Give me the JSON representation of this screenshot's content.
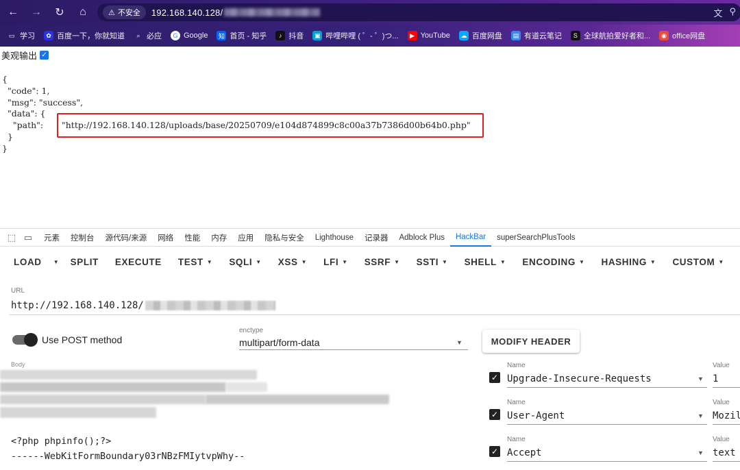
{
  "browser": {
    "security_label": "不安全",
    "address": "192.168.140.128/",
    "bookmarks": [
      {
        "label": "学习",
        "icon": "folder-icon",
        "color": "#f0eef9"
      },
      {
        "label": "百度一下，你就知道",
        "icon": "baidu-icon",
        "color": "#2932e1"
      },
      {
        "label": "必应",
        "icon": "search-icon",
        "color": "#5b9bd5"
      },
      {
        "label": "Google",
        "icon": "google-icon",
        "color": "#ffffff"
      },
      {
        "label": "首页 - 知乎",
        "icon": "zhihu-icon",
        "color": "#0066ff"
      },
      {
        "label": "抖音",
        "icon": "douyin-icon",
        "color": "#111111"
      },
      {
        "label": "哔哩哔哩 ( ゜- ゜)つ...",
        "icon": "bilibili-icon",
        "color": "#00a1d6"
      },
      {
        "label": "YouTube",
        "icon": "youtube-icon",
        "color": "#ff0000"
      },
      {
        "label": "百度网盘",
        "icon": "baidupan-icon",
        "color": "#06a7ff"
      },
      {
        "label": "有道云笔记",
        "icon": "youdao-icon",
        "color": "#3a87f2"
      },
      {
        "label": "全球航拍爱好者和...",
        "icon": "skypixel-icon",
        "color": "#111111"
      },
      {
        "label": "office网盘",
        "icon": "office-icon",
        "color": "#e94c3b"
      }
    ]
  },
  "page": {
    "pretty_print_label": "美观输出",
    "json_lines": "{\n  \"code\": 1,\n  \"msg\": \"success\",\n  \"data\": {\n    \"path\": ",
    "json_tail": "  }\n}",
    "path_value": "\"http://192.168.140.128/uploads/base/20250709/e104d874899c8c00a37b7386d00b64b0.php\""
  },
  "devtools": {
    "tabs": [
      "元素",
      "控制台",
      "源代码/来源",
      "网络",
      "性能",
      "内存",
      "应用",
      "隐私与安全",
      "Lighthouse",
      "记录器",
      "Adblock Plus",
      "HackBar",
      "superSearchPlusTools"
    ],
    "active_tab": "HackBar"
  },
  "hackbar": {
    "menu": {
      "load": "LOAD",
      "split": "SPLIT",
      "execute": "EXECUTE",
      "test": "TEST",
      "sqli": "SQLI",
      "xss": "XSS",
      "lfi": "LFI",
      "ssrf": "SSRF",
      "ssti": "SSTI",
      "shell": "SHELL",
      "encoding": "ENCODING",
      "hashing": "HASHING",
      "custom": "CUSTOM"
    },
    "url_label": "URL",
    "url_value": "http://192.168.140.128/",
    "post_label": "Use POST method",
    "post_enabled": true,
    "enctype_label": "enctype",
    "enctype_value": "multipart/form-data",
    "modify_header_label": "MODIFY HEADER",
    "body_label": "Body",
    "body_code": "<?php phpinfo();?>\n------WebKitFormBoundary03rNBzFMIytvpWhy--",
    "headers": [
      {
        "name_label": "Name",
        "name": "Upgrade-Insecure-Requests",
        "value_label": "Value",
        "value": "1",
        "enabled": true
      },
      {
        "name_label": "Name",
        "name": "User-Agent",
        "value_label": "Value",
        "value": "Mozil",
        "enabled": true
      },
      {
        "name_label": "Name",
        "name": "Accept",
        "value_label": "Value",
        "value": "text",
        "enabled": true
      }
    ]
  }
}
